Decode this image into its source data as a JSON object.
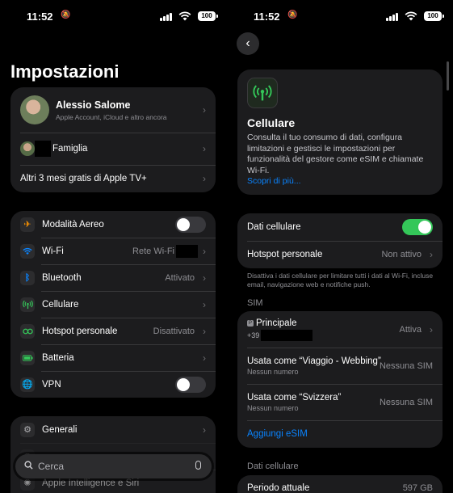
{
  "status_bar": {
    "time": "11:52",
    "battery": "100"
  },
  "left": {
    "title": "Impostazioni",
    "account": {
      "name": "Alessio Salome",
      "subtitle": "Apple Account, iCloud e altro ancora",
      "family": "Famiglia",
      "promo": "Altri 3 mesi gratis di Apple TV+"
    },
    "connectivity": [
      {
        "label": "Modalità Aereo",
        "icon": "airplane-icon",
        "color": "#ff9500",
        "control": "toggle-off"
      },
      {
        "label": "Wi-Fi",
        "icon": "wifi-icon",
        "color": "#0a84ff",
        "value": "Rete Wi-Fi"
      },
      {
        "label": "Bluetooth",
        "icon": "bluetooth-icon",
        "color": "#0a84ff",
        "value": "Attivato"
      },
      {
        "label": "Cellulare",
        "icon": "antenna-icon",
        "color": "#34c759",
        "value": ""
      },
      {
        "label": "Hotspot personale",
        "icon": "hotspot-icon",
        "color": "#34c759",
        "value": "Disattivato"
      },
      {
        "label": "Batteria",
        "icon": "battery-icon",
        "color": "#34c759",
        "value": ""
      },
      {
        "label": "VPN",
        "icon": "vpn-globe-icon",
        "color": "#0a84ff",
        "control": "toggle-off"
      }
    ],
    "general": {
      "label": "Generali"
    },
    "behind_search": {
      "partial": "Apple Intelligence e Siri"
    },
    "search": {
      "placeholder": "Cerca"
    }
  },
  "right": {
    "hero": {
      "title": "Cellulare",
      "description": "Consulta il tuo consumo di dati, configura limitazioni e gestisci le impostazioni per funzionalità del gestore come eSIM e chiamate Wi-Fi.",
      "link": "Scopri di più..."
    },
    "data_card": {
      "cellular_data": "Dati cellulare",
      "hotspot": "Hotspot personale",
      "hotspot_value": "Non attivo"
    },
    "data_note": "Disattiva i dati cellulare per limitare tutti i dati al Wi-Fi, incluse email, navigazione web e notifiche push.",
    "sim_section": "SIM",
    "sims": [
      {
        "title": "Principale",
        "sub": "+39",
        "value": "Attiva",
        "chevron": true
      },
      {
        "title": "Usata come “Viaggio - Webbing”",
        "sub": "Nessun numero",
        "value": "Nessuna SIM",
        "chevron": false
      },
      {
        "title": "Usata come “Svizzera”",
        "sub": "Nessun numero",
        "value": "Nessuna SIM",
        "chevron": false
      }
    ],
    "add_esim": "Aggiungi eSIM",
    "usage_section": "Dati cellulare",
    "current_period": {
      "label": "Periodo attuale",
      "value": "597 GB"
    }
  },
  "colors": {
    "green": "#34c759",
    "blue": "#0a84ff",
    "card": "#1c1c1e"
  }
}
